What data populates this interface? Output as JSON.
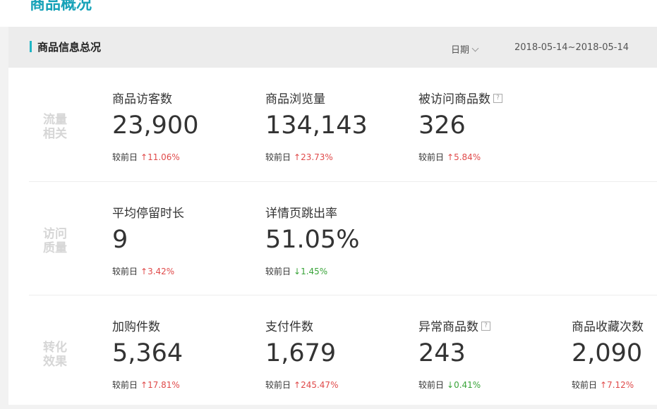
{
  "page_title": "商品概况",
  "card": {
    "title": "商品信息总况",
    "date_label": "日期",
    "date_range": "2018-05-14~2018-05-14"
  },
  "compare_label": "较前日",
  "sections": [
    {
      "category": "流量相关",
      "metrics": [
        {
          "label": "商品访客数",
          "value": "23,900",
          "change": "11.06%",
          "direction": "up",
          "help": false
        },
        {
          "label": "商品浏览量",
          "value": "134,143",
          "change": "23.73%",
          "direction": "up",
          "help": false
        },
        {
          "label": "被访问商品数",
          "value": "326",
          "change": "5.84%",
          "direction": "up",
          "help": true
        }
      ]
    },
    {
      "category": "访问质量",
      "metrics": [
        {
          "label": "平均停留时长",
          "value": "9",
          "change": "3.42%",
          "direction": "up",
          "help": false
        },
        {
          "label": "详情页跳出率",
          "value": "51.05%",
          "change": "1.45%",
          "direction": "down",
          "help": false
        }
      ]
    },
    {
      "category": "转化效果",
      "metrics": [
        {
          "label": "加购件数",
          "value": "5,364",
          "change": "17.81%",
          "direction": "up",
          "help": false
        },
        {
          "label": "支付件数",
          "value": "1,679",
          "change": "245.47%",
          "direction": "up",
          "help": false
        },
        {
          "label": "异常商品数",
          "value": "243",
          "change": "0.41%",
          "direction": "down",
          "help": true
        },
        {
          "label": "商品收藏次数",
          "value": "2,090",
          "change": "7.12%",
          "direction": "up",
          "help": false
        }
      ]
    }
  ],
  "colors": {
    "accent": "#1fb5c4",
    "up": "#e04a4a",
    "down": "#3aa43a"
  },
  "icons": {
    "help": "question-icon",
    "up": "arrow-up-icon",
    "down": "arrow-down-icon",
    "dropdown": "chevron-down-icon"
  }
}
